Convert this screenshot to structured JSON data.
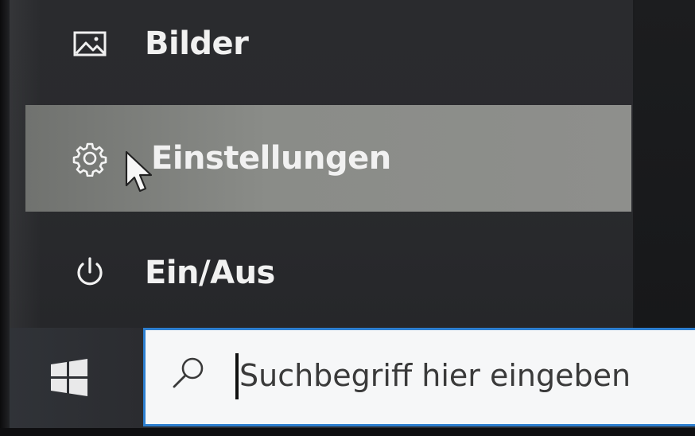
{
  "start_menu": {
    "items": [
      {
        "label": "Bilder",
        "icon": "pictures-icon"
      },
      {
        "label": "Einstellungen",
        "icon": "gear-icon"
      },
      {
        "label": "Ein/Aus",
        "icon": "power-icon"
      }
    ]
  },
  "taskbar": {
    "start_icon": "windows-logo-icon",
    "search": {
      "icon": "search-icon",
      "placeholder": "Suchbegriff hier eingeben",
      "value": ""
    }
  },
  "colors": {
    "menu_background": "#2a2b2e",
    "hover_background": "#8a8c88",
    "search_border": "#2d7fd0",
    "search_background": "#f6f7f8"
  }
}
